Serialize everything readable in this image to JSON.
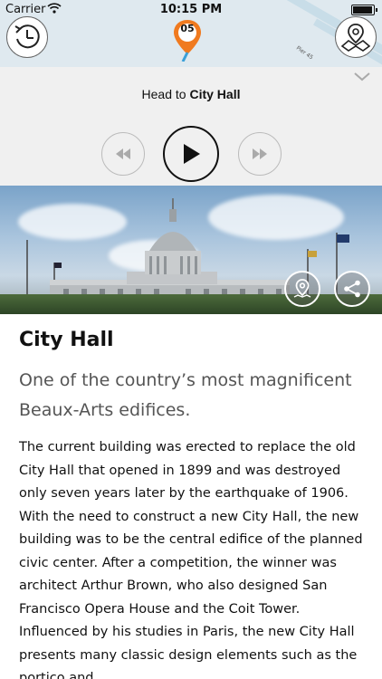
{
  "status_bar": {
    "carrier": "Carrier",
    "time": "10:15 PM",
    "battery_level": 1.0
  },
  "map": {
    "pin_number": "05",
    "pier_label": "Pier 45",
    "accent_color": "#f07a1f",
    "left_button_icon": "clock-icon",
    "right_button_icon": "places-icon"
  },
  "player": {
    "instruction_prefix": "Head to",
    "instruction_target": "City Hall",
    "rewind_icon": "rewind-icon",
    "play_icon": "play-icon",
    "forward_icon": "fast-forward-icon"
  },
  "hero": {
    "image_subject": "City Hall",
    "map_button_icon": "map-pin-icon",
    "share_button_icon": "share-icon"
  },
  "article": {
    "title": "City Hall",
    "lede": "One of the country’s most magnificent Beaux-Arts edifices.",
    "body": "The current building was erected to replace the old City Hall that opened in 1899 and was destroyed only seven years later by the earthquake of 1906. With the need to construct a new City Hall, the new building was to be the central edifice of the planned civic center. After a competition, the winner was architect Arthur Brown, who also designed San Francisco Opera House and the Coit Tower. Influenced by his studies in Paris, the new City Hall presents many classic design elements such as the portico and"
  }
}
